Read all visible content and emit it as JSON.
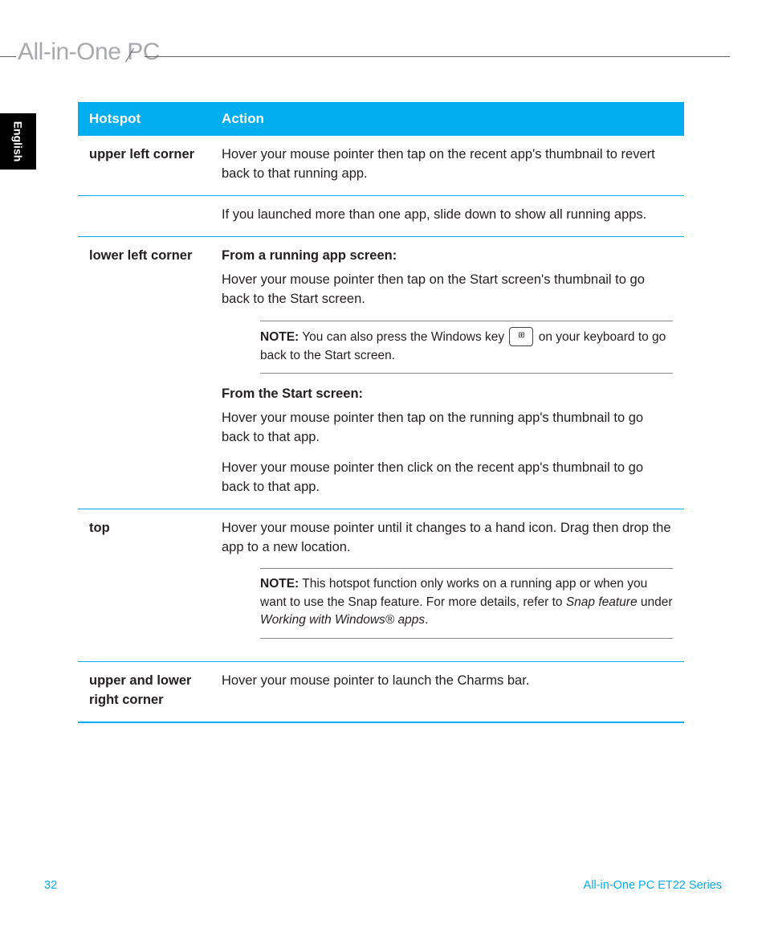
{
  "header": {
    "title": "All-in-One PC"
  },
  "sidebar": {
    "lang": "English"
  },
  "table": {
    "head": {
      "c1": "Hotspot",
      "c2": "Action"
    },
    "rows": [
      {
        "hotspot": "upper left corner",
        "action": "Hover your mouse pointer then tap on the recent app's thumbnail to revert back to that running app."
      },
      {
        "hotspot": "",
        "action": "If you launched more than one app, slide down to show all running apps."
      },
      {
        "hotspot": "lower left corner",
        "sub1": "From a running app screen:",
        "p1": "Hover your mouse pointer then tap on the Start screen's thumbnail to go back to the Start screen.",
        "note1_label": "NOTE:",
        "note1_a": "You can also press the Windows key",
        "note1_b": "on your keyboard to go back to the Start screen.",
        "sub2": "From the Start screen:",
        "p2": "Hover your mouse pointer then tap on the running app's thumbnail to go back to that app.",
        "p3": "Hover your mouse pointer then click on the recent app's thumbnail to go back to that app."
      },
      {
        "hotspot": "top",
        "p1": "Hover your mouse pointer until it changes to a hand icon. Drag then drop the app to a new location.",
        "note1_label": "NOTE:",
        "note1_a": "This hotspot function only works on a running app or when you want to use the Snap feature. For more details, refer to ",
        "note1_ref1": "Snap feature",
        "note1_b": " under ",
        "note1_ref2": "Working with Windows® apps",
        "note1_c": "."
      },
      {
        "hotspot": "upper and lower right corner",
        "action": "Hover your mouse pointer to launch the Charms bar."
      }
    ]
  },
  "footer": {
    "page": "32",
    "series": "All-in-One PC ET22 Series"
  },
  "icons": {
    "windows_key": "⊞"
  }
}
